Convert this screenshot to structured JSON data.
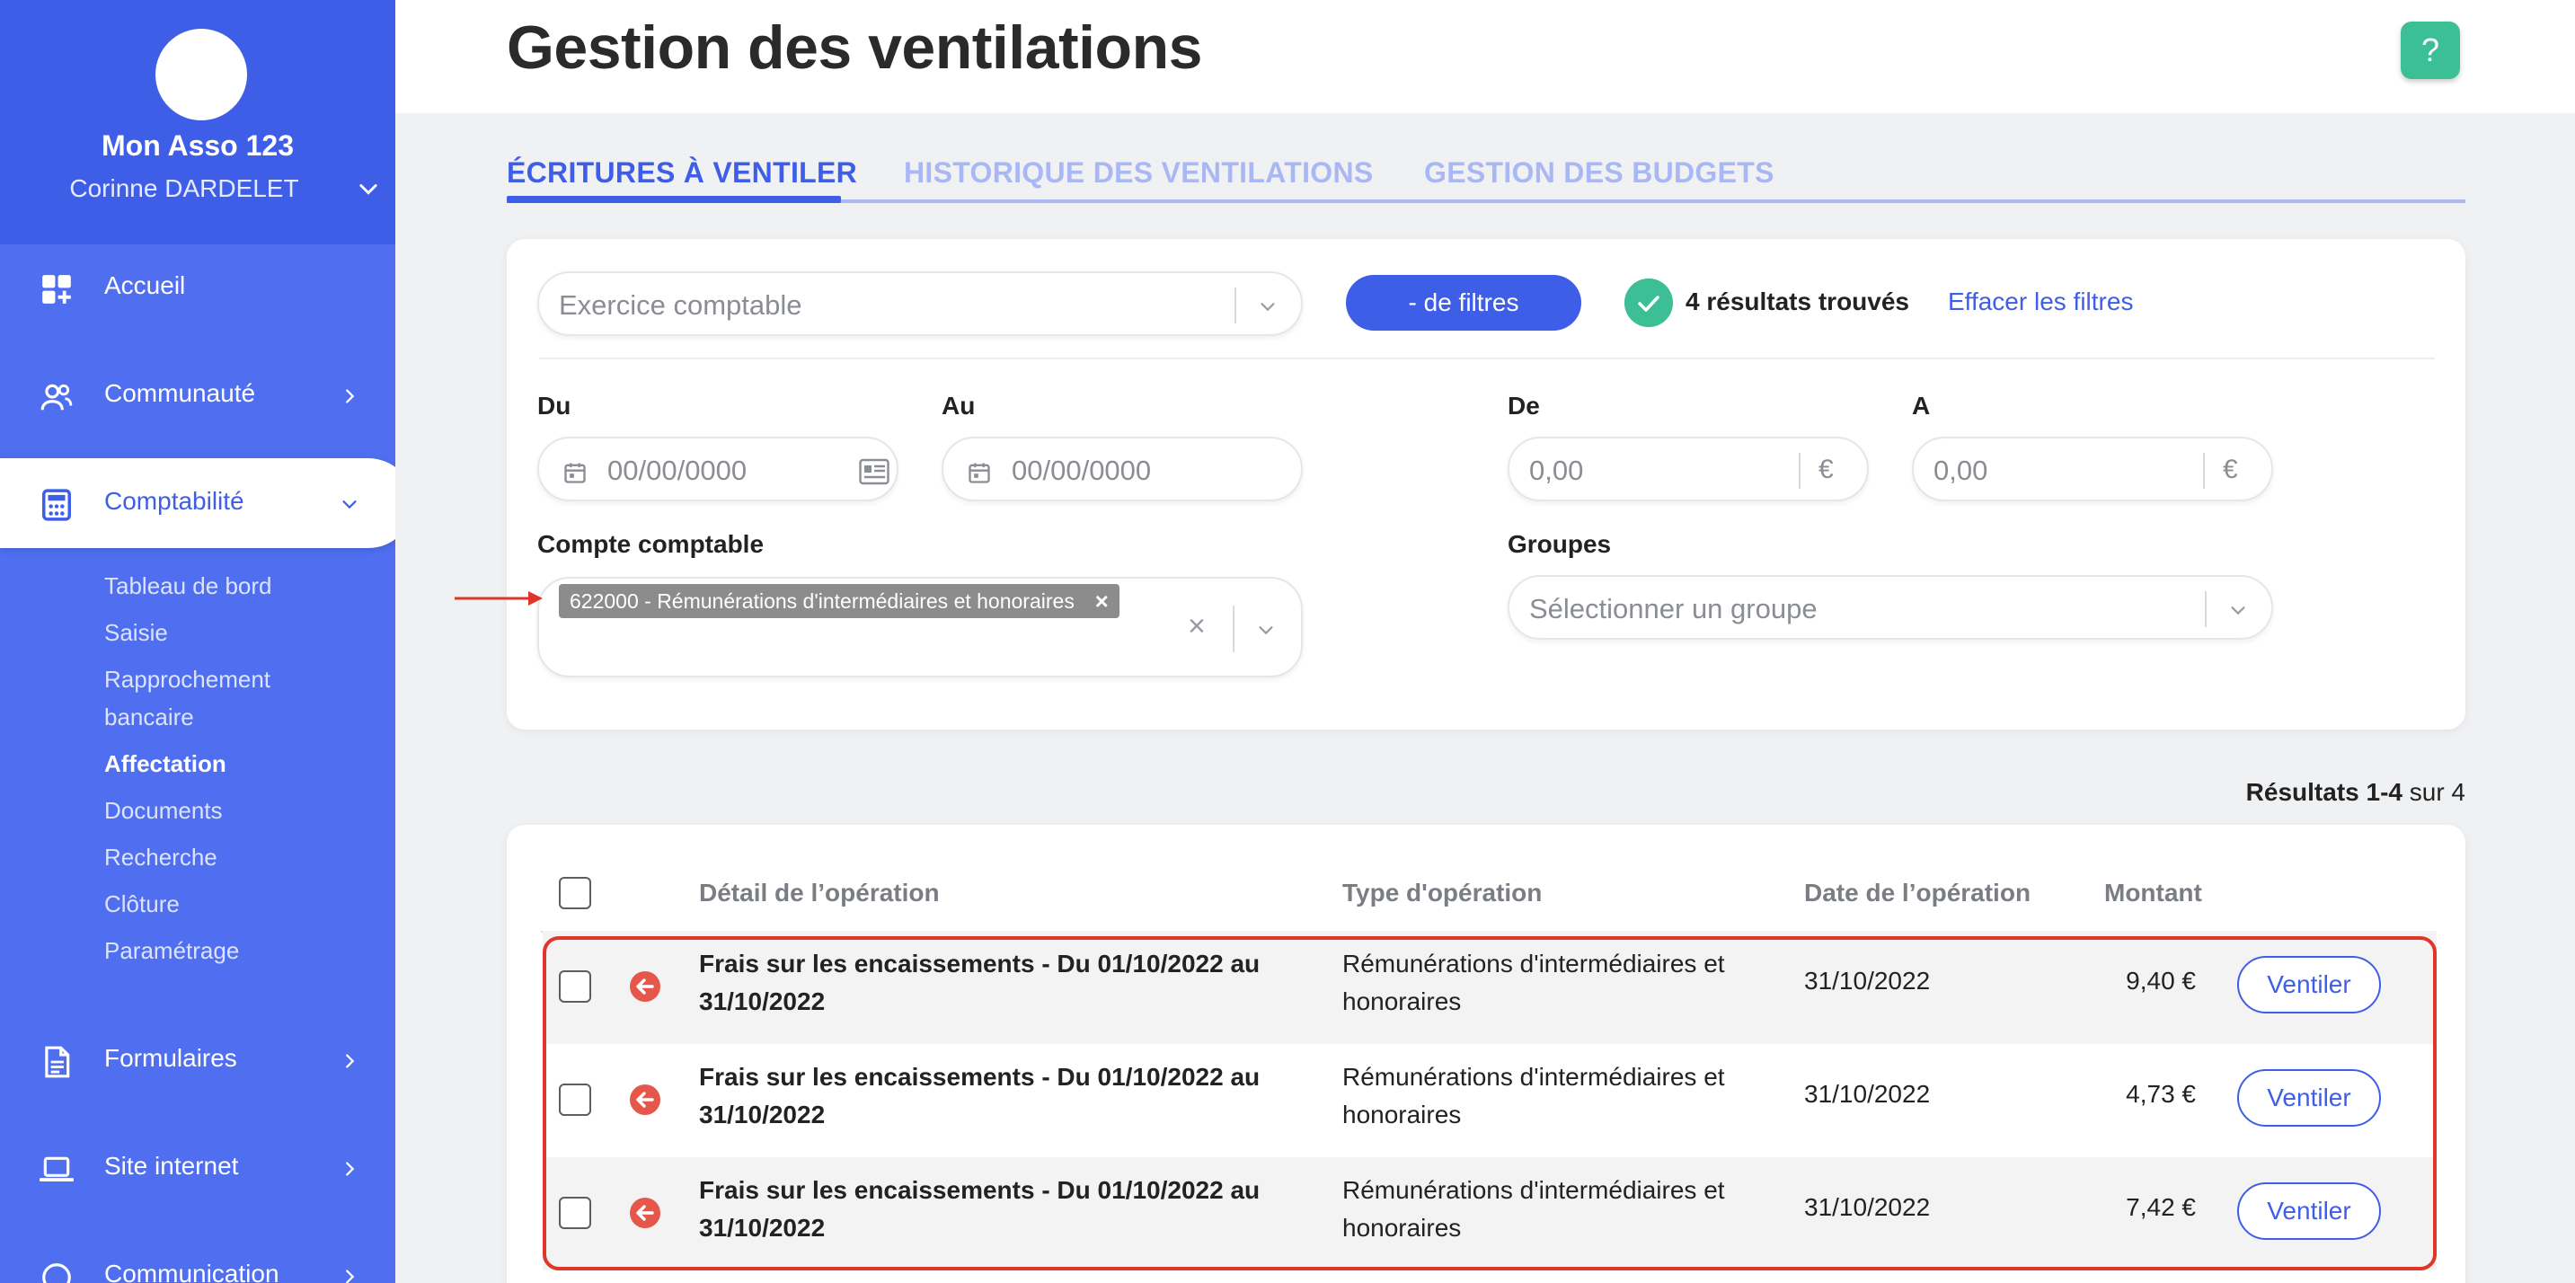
{
  "sidebar": {
    "org_name": "Mon Asso 123",
    "user_name": "Corinne DARDELET",
    "items": [
      {
        "label": "Accueil",
        "icon": "dashboard-icon"
      },
      {
        "label": "Communauté",
        "icon": "community-icon"
      },
      {
        "label": "Comptabilité",
        "icon": "calculator-icon",
        "active": true
      },
      {
        "label": "Formulaires",
        "icon": "document-icon"
      },
      {
        "label": "Site internet",
        "icon": "laptop-icon"
      },
      {
        "label": "Communication",
        "icon": "chat-icon"
      }
    ],
    "sub_items": [
      "Tableau de bord",
      "Saisie",
      "Rapprochement",
      "bancaire",
      "Affectation",
      "Documents",
      "Recherche",
      "Clôture",
      "Paramétrage"
    ],
    "active_sub_item": "Affectation"
  },
  "header": {
    "title": "Gestion des ventilations",
    "help_label": "?"
  },
  "tabs": [
    {
      "label": "ÉCRITURES À VENTILER",
      "active": true
    },
    {
      "label": "HISTORIQUE DES VENTILATIONS"
    },
    {
      "label": "GESTION DES BUDGETS"
    }
  ],
  "filters": {
    "exercise_placeholder": "Exercice comptable",
    "less_filters_label": "- de filtres",
    "results_found": "4 résultats trouvés",
    "clear_filters": "Effacer les filtres",
    "du_label": "Du",
    "au_label": "Au",
    "de_label": "De",
    "a_label": "A",
    "date_placeholder": "00/00/0000",
    "amount_placeholder": "0,00",
    "currency": "€",
    "account_label": "Compte comptable",
    "account_tag": "622000 - Rémunérations d'intermédiaires et honoraires",
    "tag_remove": "×",
    "clear_all": "×",
    "groups_label": "Groupes",
    "groups_placeholder": "Sélectionner un groupe"
  },
  "results": {
    "prefix": "Résultats ",
    "range": "1-4",
    "suffix": " sur 4"
  },
  "table": {
    "columns": [
      "Détail de l’opération",
      "Type d'opération",
      "Date de l’opération",
      "Montant"
    ],
    "action_label": "Ventiler",
    "rows": [
      {
        "detail_1": "Frais sur les encaissements - Du 01/10/2022 au",
        "detail_2": "31/10/2022",
        "type_1": "Rémunérations d'intermédiaires et",
        "type_2": "honoraires",
        "date": "31/10/2022",
        "amount": "9,40 €"
      },
      {
        "detail_1": "Frais sur les encaissements - Du 01/10/2022 au",
        "detail_2": "31/10/2022",
        "type_1": "Rémunérations d'intermédiaires et",
        "type_2": "honoraires",
        "date": "31/10/2022",
        "amount": "4,73 €"
      },
      {
        "detail_1": "Frais sur les encaissements - Du 01/10/2022 au",
        "detail_2": "31/10/2022",
        "type_1": "Rémunérations d'intermédiaires et",
        "type_2": "honoraires",
        "date": "31/10/2022",
        "amount": "7,42 €"
      }
    ]
  },
  "colors": {
    "sidebar": "#4f6ff0",
    "primary": "#3e5ee8",
    "success": "#3dbf95",
    "annotation": "#e0362a"
  }
}
